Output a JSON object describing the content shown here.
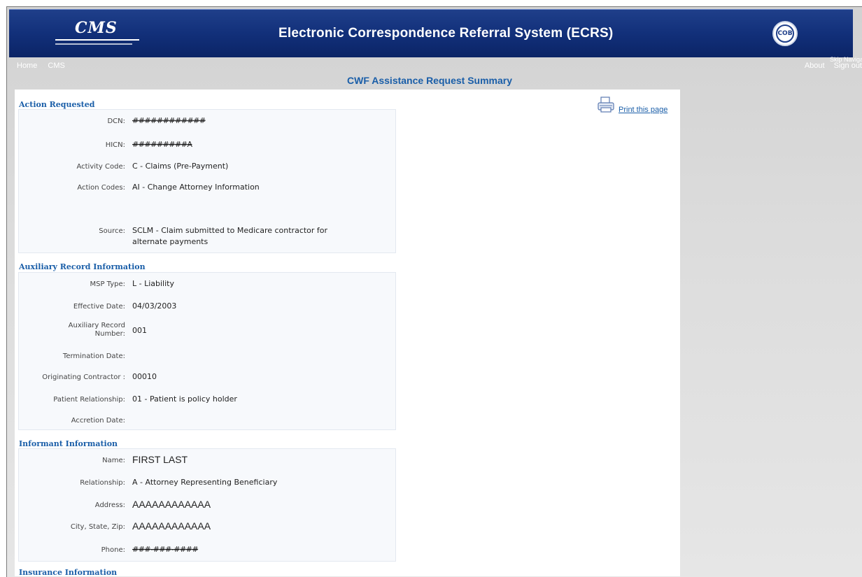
{
  "header": {
    "logo_text": "CMS",
    "app_title": "Electronic Correspondence Referral System (ECRS)",
    "seal_text": "COB"
  },
  "nav": {
    "left": [
      "Home",
      "CMS"
    ],
    "right": [
      "About",
      "Sign out"
    ],
    "skip_link": "Skip Navigation"
  },
  "page_title": "CWF Assistance Request Summary",
  "print_link": "Print this page",
  "action_requested": {
    "title": "Action Requested",
    "dcn_label": "DCN:",
    "dcn_value": "############",
    "hicn_label": "HICN:",
    "hicn_value": "#########A",
    "activity_code_label": "Activity Code:",
    "activity_code_value": "C - Claims (Pre-Payment)",
    "action_codes_label": "Action Codes:",
    "action_codes_value": "AI - Change Attorney Information",
    "source_label": "Source:",
    "source_value_line1": "SCLM - Claim submitted to Medicare contractor for",
    "source_value_line2": "alternate payments"
  },
  "auxiliary_record": {
    "title": "Auxiliary Record Information",
    "msp_type_label": "MSP Type:",
    "msp_type_value": "L - Liability",
    "effective_date_label": "Effective Date:",
    "effective_date_value": "04/03/2003",
    "aux_record_number_label_1": "Auxiliary Record",
    "aux_record_number_label_2": "Number:",
    "aux_record_number_value": "001",
    "termination_date_label": "Termination Date:",
    "termination_date_value": "",
    "originating_contractor_label": "Originating Contractor :",
    "originating_contractor_value": "00010",
    "patient_relationship_label": "Patient Relationship:",
    "patient_relationship_value": "01 - Patient is policy holder",
    "accretion_date_label": "Accretion Date:",
    "accretion_date_value": ""
  },
  "informant": {
    "title": "Informant Information",
    "name_label": "Name:",
    "name_value": "FIRST LAST",
    "relationship_label": "Relationship:",
    "relationship_value": "A - Attorney Representing Beneficiary",
    "address_label": "Address:",
    "address_value": "AAAAAAAAAAAA",
    "city_label": "City, State, Zip:",
    "city_value": "AAAAAAAAAAAA",
    "phone_label": "Phone:",
    "phone_value": "###-###-####"
  },
  "insurance": {
    "title": "Insurance Information"
  },
  "colors": {
    "header_blue": "#12307a",
    "link_blue": "#1a5ea8",
    "panel_bg": "#f7f9fc"
  }
}
